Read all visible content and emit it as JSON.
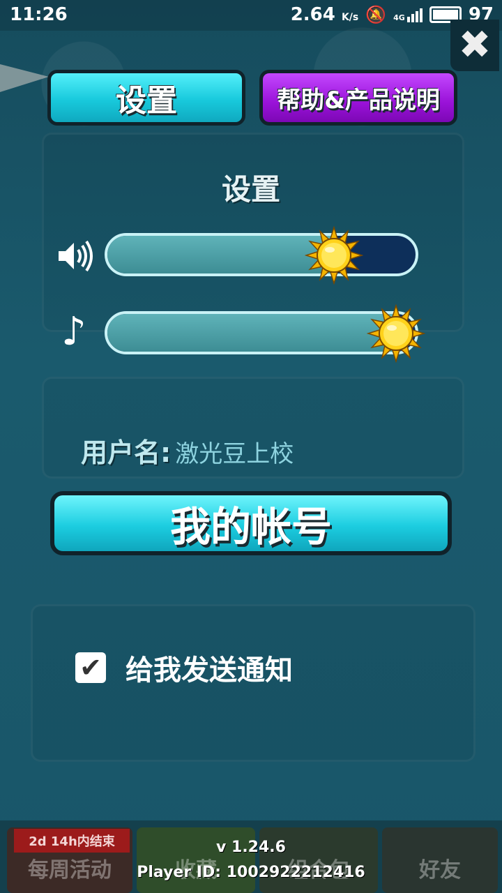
{
  "status_bar": {
    "time": "11:26",
    "speed": "2.64",
    "speed_unit": "K/s",
    "network": "4G",
    "battery": "97"
  },
  "tabs": {
    "settings_label": "设置",
    "help_label": "帮助&产品说明"
  },
  "settings": {
    "title": "设置",
    "sound_volume": 0.77,
    "music_volume": 1.0,
    "sound_icon": "speaker-icon",
    "music_icon": "music-note-icon"
  },
  "user": {
    "label": "用户名:",
    "name": "激光豆上校"
  },
  "account_button": "我的帐号",
  "notifications": {
    "checked": true,
    "label": "给我发送通知"
  },
  "bottom_nav": {
    "weekly_banner": "2d 14h内结束",
    "weekly": "每周活动",
    "collection": "收藏",
    "packs": "组合包",
    "friends": "好友"
  },
  "version": {
    "version": "v 1.24.6",
    "player_id": "Player ID: 1002922212416"
  },
  "colors": {
    "tab_settings": "#18c9dc",
    "tab_help": "#9a12d8",
    "background": "#1b5a6e"
  }
}
